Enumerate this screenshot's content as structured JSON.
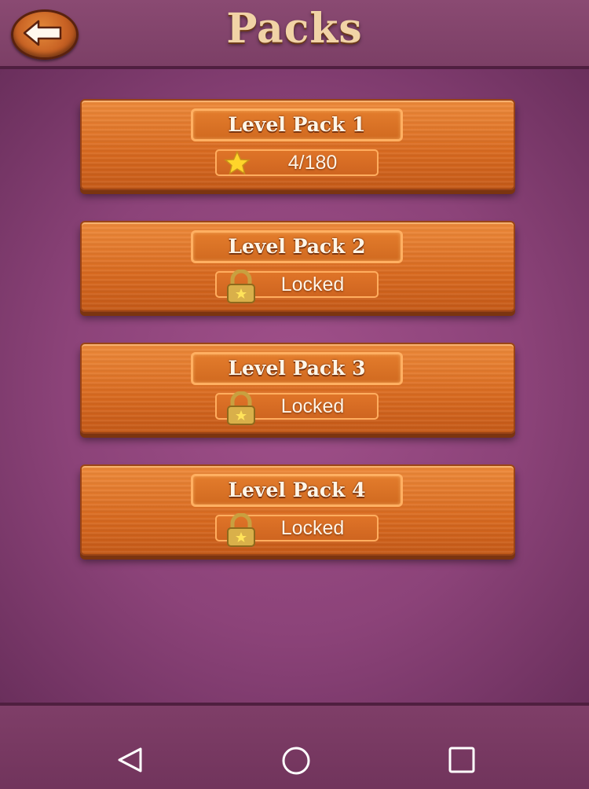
{
  "header": {
    "title": "Packs",
    "back_icon": "arrow-left-icon"
  },
  "packs": [
    {
      "label": "Level Pack 1",
      "status": "4/180",
      "status_icon": "star-icon",
      "locked": false
    },
    {
      "label": "Level Pack 2",
      "status": "Locked",
      "status_icon": "lock-icon",
      "locked": true
    },
    {
      "label": "Level Pack 3",
      "status": "Locked",
      "status_icon": "lock-icon",
      "locked": true
    },
    {
      "label": "Level Pack 4",
      "status": "Locked",
      "status_icon": "lock-icon",
      "locked": true
    }
  ],
  "navbar": {
    "icons": [
      "back-triangle-icon",
      "home-circle-icon",
      "recents-square-icon"
    ]
  },
  "colors": {
    "background": "#8c4379",
    "panel": "#d8691f",
    "title_text": "#f1d3a6"
  }
}
